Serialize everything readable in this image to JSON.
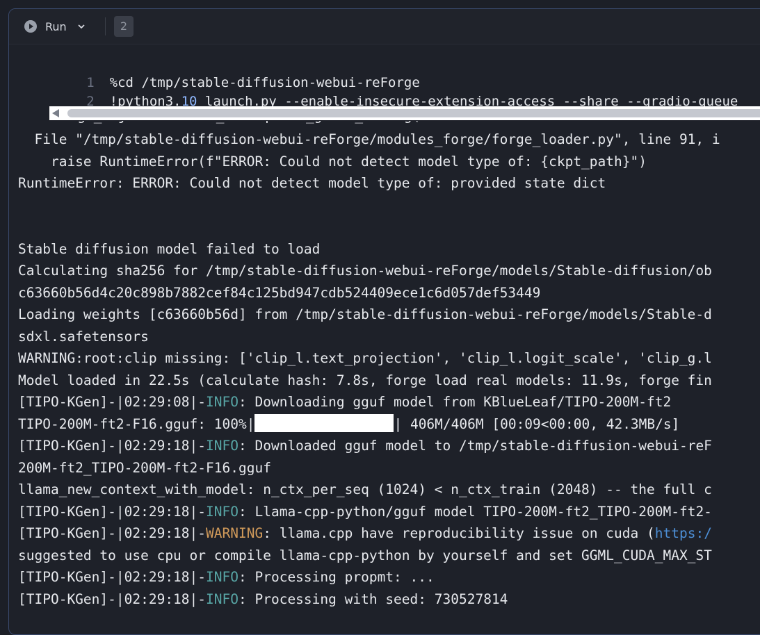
{
  "toolbar": {
    "run_label": "Run",
    "execution_count": "2"
  },
  "editor": {
    "lines": [
      {
        "num": "1",
        "text": "%cd /tmp/stable-diffusion-webui-reForge"
      },
      {
        "num": "2",
        "pre": "!python3.",
        "numeric": "10",
        "post": " launch.py --enable-insecure-extension-access --share --gradio-queue"
      }
    ]
  },
  "output": {
    "partial_line": "forge_objects = load_checkpoint_guess_config(",
    "lines": [
      {
        "text": "  File \"/tmp/stable-diffusion-webui-reForge/modules_forge/forge_loader.py\", line 91, i"
      },
      {
        "text": "    raise RuntimeError(f\"ERROR: Could not detect model type of: {ckpt_path}\")"
      },
      {
        "text": "RuntimeError: ERROR: Could not detect model type of: provided state dict"
      },
      {
        "text": ""
      },
      {
        "text": ""
      },
      {
        "text": "Stable diffusion model failed to load"
      },
      {
        "text": "Calculating sha256 for /tmp/stable-diffusion-webui-reForge/models/Stable-diffusion/ob"
      },
      {
        "text": "c63660b56d4c20c898b7882cef84c125bd947cdb524409ece1c6d057def53449"
      },
      {
        "text": "Loading weights [c63660b56d] from /tmp/stable-diffusion-webui-reForge/models/Stable-d"
      },
      {
        "text": "sdxl.safetensors"
      },
      {
        "text": "WARNING:root:clip missing: ['clip_l.text_projection', 'clip_l.logit_scale', 'clip_g.l"
      },
      {
        "text": "Model loaded in 22.5s (calculate hash: 7.8s, forge load real models: 11.9s, forge fin"
      },
      {
        "prefix": "[TIPO-KGen]-|02:29:08|-",
        "level": "INFO",
        "msg": ": Downloading gguf model from KBlueLeaf/TIPO-200M-ft2"
      },
      {
        "progress_pre": "TIPO-200M-ft2-F16.gguf: 100%|",
        "progress_value": 1.0,
        "progress_post": "| 406M/406M [00:09<00:00, 42.3MB/s]"
      },
      {
        "prefix": "[TIPO-KGen]-|02:29:18|-",
        "level": "INFO",
        "msg": ": Downloaded gguf model to /tmp/stable-diffusion-webui-reF"
      },
      {
        "text": "200M-ft2_TIPO-200M-ft2-F16.gguf"
      },
      {
        "text": "llama_new_context_with_model: n_ctx_per_seq (1024) < n_ctx_train (2048) -- the full c"
      },
      {
        "prefix": "[TIPO-KGen]-|02:29:18|-",
        "level": "INFO",
        "msg": ": Llama-cpp-python/gguf model TIPO-200M-ft2_TIPO-200M-ft2-"
      },
      {
        "prefix": "[TIPO-KGen]-|02:29:18|-",
        "level": "WARNING",
        "msg": ": llama.cpp have reproducibility issue on cuda (",
        "link": "https:/"
      },
      {
        "text": "suggested to use cpu or compile llama-cpp-python by yourself and set GGML_CUDA_MAX_ST"
      },
      {
        "prefix": "[TIPO-KGen]-|02:29:18|-",
        "level": "INFO",
        "msg": ": Processing propmt: ..."
      },
      {
        "prefix": "[TIPO-KGen]-|02:29:18|-",
        "level": "INFO",
        "msg": ": Processing with seed: 730527814"
      }
    ]
  },
  "colors": {
    "info": "#58a6a6",
    "warning": "#d09a5a",
    "link": "#4d8fd6",
    "number": "#8fb8ff"
  }
}
